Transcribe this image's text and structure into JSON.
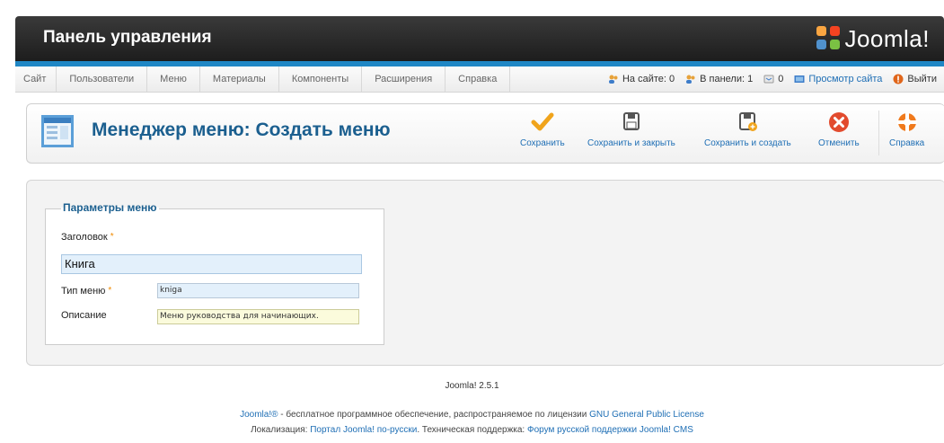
{
  "header": {
    "title": "Панель управления",
    "logo_text": "Joomla!",
    "bar_color": "#1d1d1d",
    "accent": "#1f87c5"
  },
  "menu": {
    "items": [
      "Сайт",
      "Пользователи",
      "Меню",
      "Материалы",
      "Компоненты",
      "Расширения",
      "Справка"
    ]
  },
  "status": {
    "on_site": "На сайте: 0",
    "in_panel": "В панели: 1",
    "messages": "0",
    "view_site": "Просмотр сайта",
    "logout": "Выйти"
  },
  "toolbar": {
    "page_title": "Менеджер меню: Создать меню",
    "save": "Сохранить",
    "save_close": "Сохранить и закрыть",
    "save_new": "Сохранить и создать",
    "cancel": "Отменить",
    "help": "Справка"
  },
  "form": {
    "legend": "Параметры меню",
    "title_label": "Заголовок",
    "title_value": "Книга",
    "menutype_label": "Тип меню",
    "menutype_value": "kniga",
    "description_label": "Описание",
    "description_value": "Меню руководства для начинающих.",
    "required_mark": "*"
  },
  "footer": {
    "version": "Joomla! 2.5.1",
    "line1_brand": "Joomla!®",
    "line1_text": " - бесплатное программное обеспечение, распространяемое по лицензии ",
    "line1_link": "GNU General Public License",
    "line2_label1": "Локализация: ",
    "line2_link1": "Портал Joomla! по-русски",
    "line2_label2": ". Техническая поддержка: ",
    "line2_link2": "Форум русской поддержки Joomla! CMS"
  }
}
